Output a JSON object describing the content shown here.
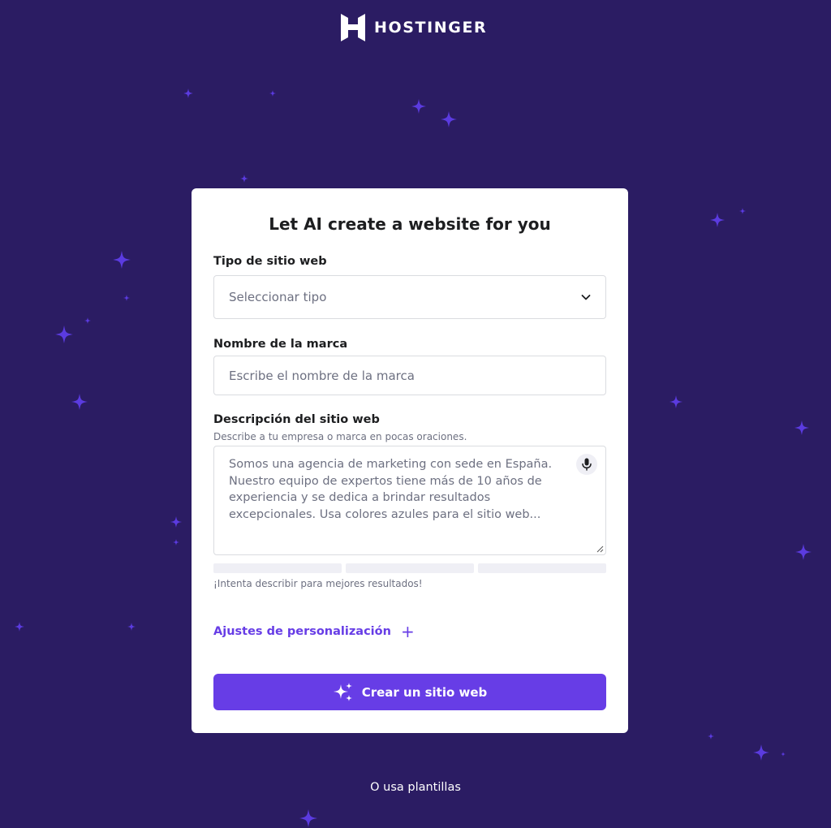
{
  "header": {
    "brand": "HOSTINGER",
    "logo_icon": "hostinger-logo-icon"
  },
  "colors": {
    "background": "#2b1c63",
    "accent": "#673de6",
    "star": "#5b3be0"
  },
  "form": {
    "title": "Let AI create a website for you",
    "type_label": "Tipo de sitio web",
    "type_placeholder": "Seleccionar tipo",
    "brand_label": "Nombre de la marca",
    "brand_placeholder": "Escribe el nombre de la marca",
    "description_label": "Descripción del sitio web",
    "description_help": "Describe a tu empresa o marca en pocas oraciones.",
    "description_placeholder": "Somos una agencia de marketing con sede en España. Nuestro equipo de expertos tiene más de 10 años de experiencia y se dedica a brindar resultados excepcionales. Usa colores azules para el sitio web...",
    "hint": "¡Intenta describir para mejores resultados!",
    "customize_label": "Ajustes de personalización",
    "customize_icon": "+",
    "submit_label": "Crear un sitio web"
  },
  "footer": {
    "templates_link": "O usa plantillas"
  }
}
